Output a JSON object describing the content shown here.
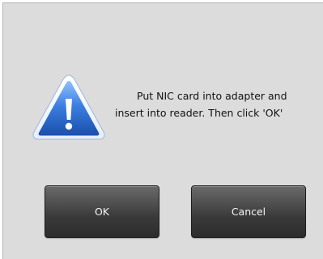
{
  "dialog": {
    "message_lines": [
      "Put NIC card into adapter and",
      "insert into reader. Then click 'OK'"
    ],
    "icon": "warning-icon",
    "ok_label": "OK",
    "cancel_label": "Cancel"
  },
  "colors": {
    "background": "#dcdcdc",
    "icon_fill": "#2a67c4",
    "button": "#3e3e3e",
    "button_text": "#f4f4f4"
  }
}
